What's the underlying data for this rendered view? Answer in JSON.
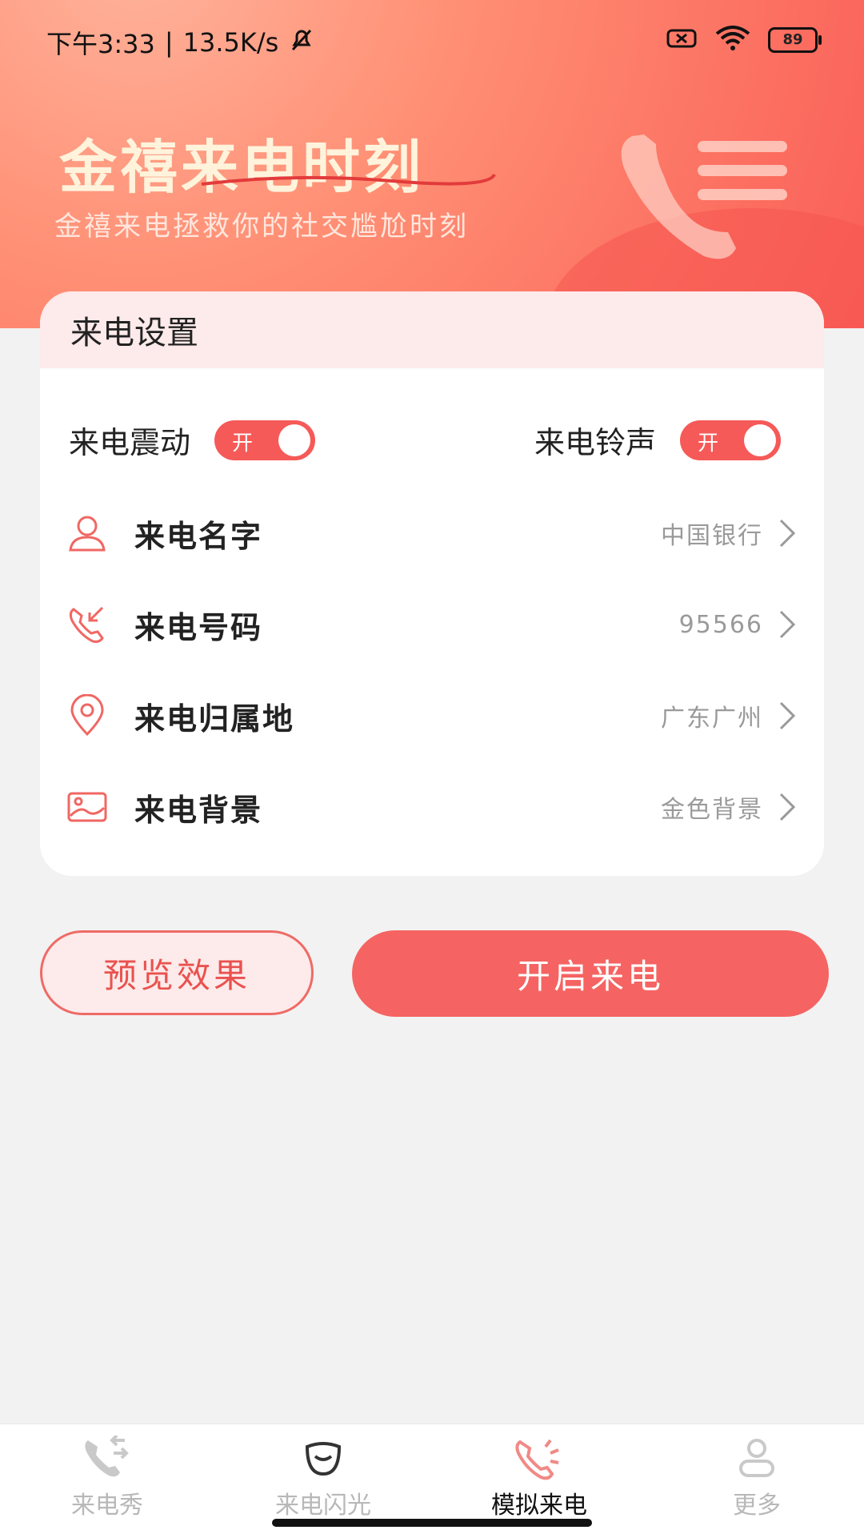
{
  "status_bar": {
    "time": "下午3:33",
    "separator": "|",
    "speed": "13.5K/s",
    "battery": "89",
    "icons": [
      "mute-bell-icon",
      "sim-off-icon",
      "wifi-icon",
      "battery-icon"
    ]
  },
  "header": {
    "title": "金禧来电时刻",
    "subtitle": "金禧来电拯救你的社交尴尬时刻"
  },
  "settings": {
    "title": "来电设置",
    "vibrate": {
      "label": "来电震动",
      "toggle_text": "开"
    },
    "ringtone": {
      "label": "来电铃声",
      "toggle_text": "开"
    },
    "rows": [
      {
        "label": "来电名字",
        "value": "中国银行",
        "icon": "person-icon"
      },
      {
        "label": "来电号码",
        "value": "95566",
        "icon": "incoming-call-icon"
      },
      {
        "label": "来电归属地",
        "value": "广东广州",
        "icon": "location-pin-icon"
      },
      {
        "label": "来电背景",
        "value": "金色背景",
        "icon": "image-icon"
      }
    ]
  },
  "buttons": {
    "preview": "预览效果",
    "start": "开启来电"
  },
  "nav": [
    {
      "label": "来电秀",
      "icon": "call-show-icon",
      "active": false
    },
    {
      "label": "来电闪光",
      "icon": "flash-icon",
      "active": false
    },
    {
      "label": "模拟来电",
      "icon": "simulate-call-icon",
      "active": true
    },
    {
      "label": "更多",
      "icon": "profile-icon",
      "active": false
    }
  ],
  "colors": {
    "accent": "#f56462",
    "header_start": "#ffb39c",
    "header_end": "#fa5e57",
    "card_header_bg": "#fdeaea",
    "text_title": "#fff3dc"
  }
}
